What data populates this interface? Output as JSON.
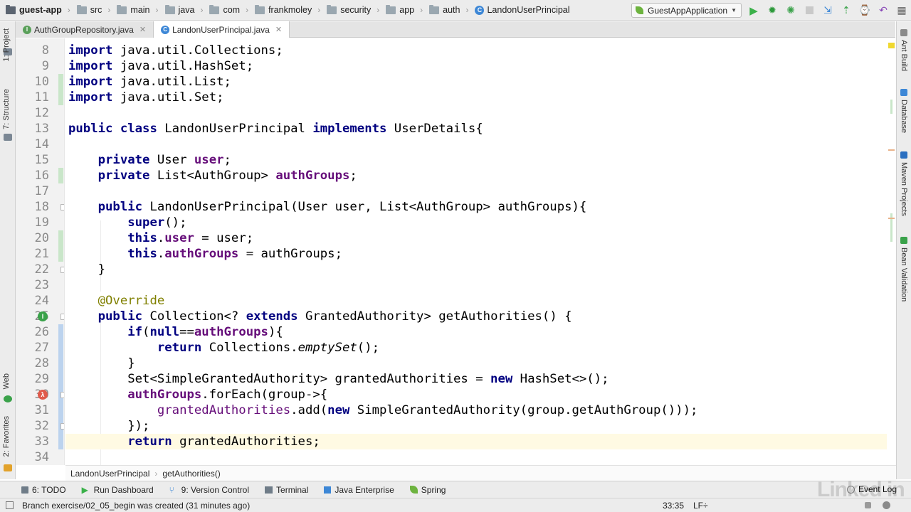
{
  "breadcrumbs": [
    {
      "label": "guest-app",
      "bold": true,
      "icon": "project-folder-icon"
    },
    {
      "label": "src",
      "icon": "folder-icon"
    },
    {
      "label": "main",
      "icon": "folder-icon"
    },
    {
      "label": "java",
      "icon": "source-folder-icon"
    },
    {
      "label": "com",
      "icon": "package-icon"
    },
    {
      "label": "frankmoley",
      "icon": "package-icon"
    },
    {
      "label": "security",
      "icon": "package-icon"
    },
    {
      "label": "app",
      "icon": "package-icon"
    },
    {
      "label": "auth",
      "icon": "package-icon"
    },
    {
      "label": "LandonUserPrincipal",
      "icon": "class-icon"
    }
  ],
  "run_config": {
    "label": "GuestAppApplication"
  },
  "tabs": [
    {
      "label": "AuthGroupRepository.java",
      "icon": "interface-icon",
      "active": false
    },
    {
      "label": "LandonUserPrincipal.java",
      "icon": "class-icon",
      "active": true
    }
  ],
  "left_tools": [
    {
      "label": "1: Project"
    },
    {
      "label": "7: Structure"
    },
    {
      "label": "Web"
    },
    {
      "label": "2: Favorites"
    }
  ],
  "right_tools": [
    {
      "label": "Ant Build"
    },
    {
      "label": "Database"
    },
    {
      "label": "Maven Projects"
    },
    {
      "label": "Bean Validation"
    }
  ],
  "code_lines": [
    {
      "n": "8",
      "html": "<span class=\"k\">import</span> java.util.Collections;"
    },
    {
      "n": "9",
      "html": "<span class=\"k\">import</span> java.util.HashSet;"
    },
    {
      "n": "10",
      "html": "<span class=\"k\">import</span> java.util.List;"
    },
    {
      "n": "11",
      "html": "<span class=\"k\">import</span> java.util.Set;"
    },
    {
      "n": "12",
      "html": ""
    },
    {
      "n": "13",
      "html": "<span class=\"k\">public class</span> LandonUserPrincipal <span class=\"k\">implements</span> UserDetails{"
    },
    {
      "n": "14",
      "html": ""
    },
    {
      "n": "15",
      "html": "    <span class=\"k\">private</span> User <span class=\"f\">user</span>;"
    },
    {
      "n": "16",
      "html": "    <span class=\"k\">private</span> List&lt;AuthGroup&gt; <span class=\"f\">authGroups</span>;"
    },
    {
      "n": "17",
      "html": ""
    },
    {
      "n": "18",
      "html": "    <span class=\"k\">public</span> LandonUserPrincipal(User user, List&lt;AuthGroup&gt; authGroups){"
    },
    {
      "n": "19",
      "html": "        <span class=\"k\">super</span>();"
    },
    {
      "n": "20",
      "html": "        <span class=\"k\">this</span>.<span class=\"f\">user</span> = user;"
    },
    {
      "n": "21",
      "html": "        <span class=\"k\">this</span>.<span class=\"f\">authGroups</span> = authGroups;"
    },
    {
      "n": "22",
      "html": "    }"
    },
    {
      "n": "23",
      "html": ""
    },
    {
      "n": "24",
      "html": "    <span class=\"a\">@Override</span>"
    },
    {
      "n": "25",
      "html": "    <span class=\"k\">public</span> Collection&lt;? <span class=\"k\">extends</span> GrantedAuthority&gt; getAuthorities() {"
    },
    {
      "n": "26",
      "html": "        <span class=\"k\">if</span>(<span class=\"k\">null</span>==<span class=\"f\">authGroups</span>){"
    },
    {
      "n": "27",
      "html": "            <span class=\"k\">return</span> Collections.<span class=\"i\">emptySet</span>();"
    },
    {
      "n": "28",
      "html": "        }"
    },
    {
      "n": "29",
      "html": "        Set&lt;SimpleGrantedAuthority&gt; grantedAuthorities = <span class=\"k\">new</span> HashSet&lt;&gt;();"
    },
    {
      "n": "30",
      "html": "        <span class=\"f\">authGroups</span>.forEach(group-&gt;{"
    },
    {
      "n": "31",
      "html": "            <span class=\"f\" style=\"font-weight:normal\">grantedAuthorities</span>.add(<span class=\"k\">new</span> SimpleGrantedAuthority(group.getAuthGroup()));"
    },
    {
      "n": "32",
      "html": "        });"
    },
    {
      "n": "33",
      "html": "        <span class=\"k\">return</span> grantedAuthorities;"
    },
    {
      "n": "34",
      "html": ""
    }
  ],
  "code_crumbs": [
    "LandonUserPrincipal",
    "getAuthorities()"
  ],
  "tool_windows": [
    {
      "label": "6: TODO",
      "icon": "todo-icon"
    },
    {
      "label": "Run Dashboard",
      "icon": "run-dashboard-icon"
    },
    {
      "label": "9: Version Control",
      "icon": "version-control-icon"
    },
    {
      "label": "Terminal",
      "icon": "terminal-icon"
    },
    {
      "label": "Java Enterprise",
      "icon": "java-enterprise-icon"
    },
    {
      "label": "Spring",
      "icon": "spring-icon"
    }
  ],
  "event_log": "Event Log",
  "status": {
    "message": "Branch exercise/02_05_begin was created (31 minutes ago)",
    "position": "33:35",
    "line_sep": "LF÷"
  },
  "watermark": "Linked in",
  "colors": {
    "keyword": "#000080",
    "field": "#660e7a",
    "annotation": "#808000",
    "caret_row": "#fffae3"
  }
}
